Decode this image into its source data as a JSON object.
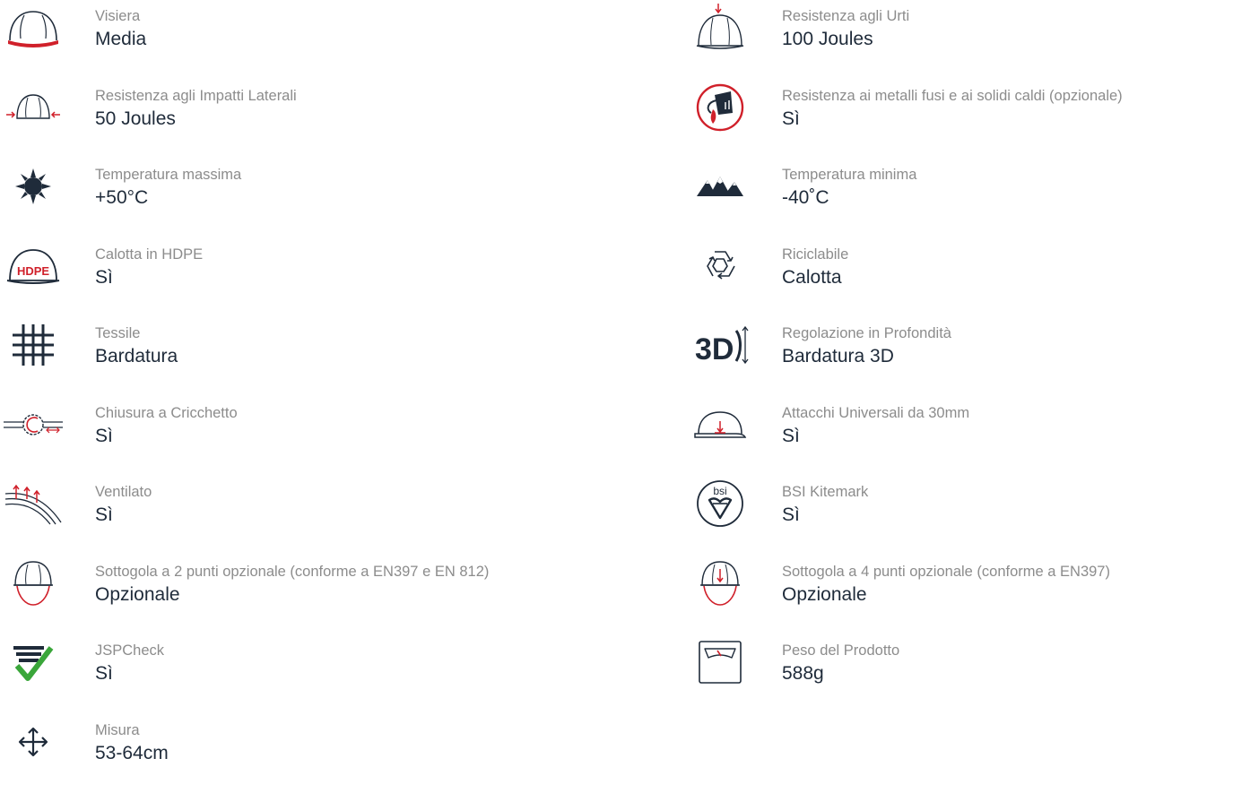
{
  "features": {
    "left": [
      {
        "icon": "helmet-visor-icon",
        "label": "Visiera",
        "value": "Media"
      },
      {
        "icon": "side-impact-icon",
        "label": "Resistenza agli Impatti Laterali",
        "value": "50 Joules"
      },
      {
        "icon": "sun-temperature-icon",
        "label": "Temperatura massima",
        "value": "+50°C"
      },
      {
        "icon": "hdpe-shell-icon",
        "icon_text": "HDPE",
        "label": "Calotta in HDPE",
        "value": "Sì"
      },
      {
        "icon": "textile-icon",
        "label": "Tessile",
        "value": "Bardatura"
      },
      {
        "icon": "ratchet-icon",
        "label": "Chiusura a Cricchetto",
        "value": "Sì"
      },
      {
        "icon": "ventilation-icon",
        "label": "Ventilato",
        "value": "Sì"
      },
      {
        "icon": "chinstrap-2-point-icon",
        "label": "Sottogola a 2 punti opzionale (conforme a EN397 e EN 812)",
        "value": "Opzionale"
      },
      {
        "icon": "jspcheck-icon",
        "label": "JSPCheck",
        "value": "Sì"
      },
      {
        "icon": "size-arrows-icon",
        "label": "Misura",
        "value": "53-64cm"
      }
    ],
    "right": [
      {
        "icon": "top-impact-icon",
        "label": "Resistenza agli Urti",
        "value": "100 Joules"
      },
      {
        "icon": "molten-metal-icon",
        "label": "Resistenza ai metalli fusi e ai solidi caldi (opzionale)",
        "value": "Sì"
      },
      {
        "icon": "mountains-temperature-icon",
        "label": "Temperatura minima",
        "value": "-40˚C"
      },
      {
        "icon": "recycle-icon",
        "label": "Riciclabile",
        "value": "Calotta"
      },
      {
        "icon": "depth-adjust-3d-icon",
        "icon_text": "3D",
        "label": "Regolazione in Profondità",
        "value": "Bardatura 3D"
      },
      {
        "icon": "universal-slots-icon",
        "label": "Attacchi Universali da 30mm",
        "value": "Sì"
      },
      {
        "icon": "bsi-kitemark-icon",
        "icon_text": "bsi",
        "label": "BSI Kitemark",
        "value": "Sì"
      },
      {
        "icon": "chinstrap-4-point-icon",
        "label": "Sottogola a 4 punti opzionale (conforme a EN397)",
        "value": "Opzionale"
      },
      {
        "icon": "weight-scale-icon",
        "label": "Peso del Prodotto",
        "value": "588g"
      }
    ]
  },
  "colors": {
    "accent_red": "#d0202a",
    "icon_navy": "#1f2b3a",
    "label_gray": "#8c8c8c",
    "check_green": "#3aa63a"
  }
}
